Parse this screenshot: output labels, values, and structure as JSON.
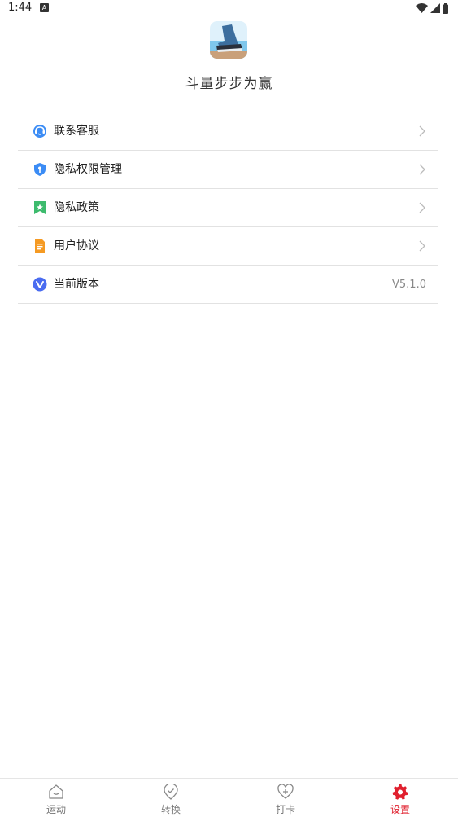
{
  "status_bar": {
    "time": "1:44",
    "notification_badge": "A"
  },
  "app": {
    "name": "斗量步步为赢",
    "logo_icon": "app-logo-icon"
  },
  "menu": {
    "items": [
      {
        "label": "联系客服",
        "icon": "customer-service-icon"
      },
      {
        "label": "隐私权限管理",
        "icon": "shield-icon"
      },
      {
        "label": "隐私政策",
        "icon": "bookmark-star-icon"
      },
      {
        "label": "用户协议",
        "icon": "document-icon"
      },
      {
        "label": "当前版本",
        "icon": "version-icon",
        "value": "V5.1.0"
      }
    ]
  },
  "tab_bar": {
    "tabs": [
      {
        "label": "运动",
        "icon": "home-icon",
        "active": false
      },
      {
        "label": "转换",
        "icon": "location-check-icon",
        "active": false
      },
      {
        "label": "打卡",
        "icon": "heart-plus-icon",
        "active": false
      },
      {
        "label": "设置",
        "icon": "gear-icon",
        "active": true
      }
    ],
    "active_color": "#e0202e",
    "inactive_color": "#777777"
  },
  "colors": {
    "divider": "#e2e2e2",
    "accent_blue": "#3b8cf5",
    "accent_green": "#3dbb6d",
    "accent_orange": "#f59a23"
  }
}
